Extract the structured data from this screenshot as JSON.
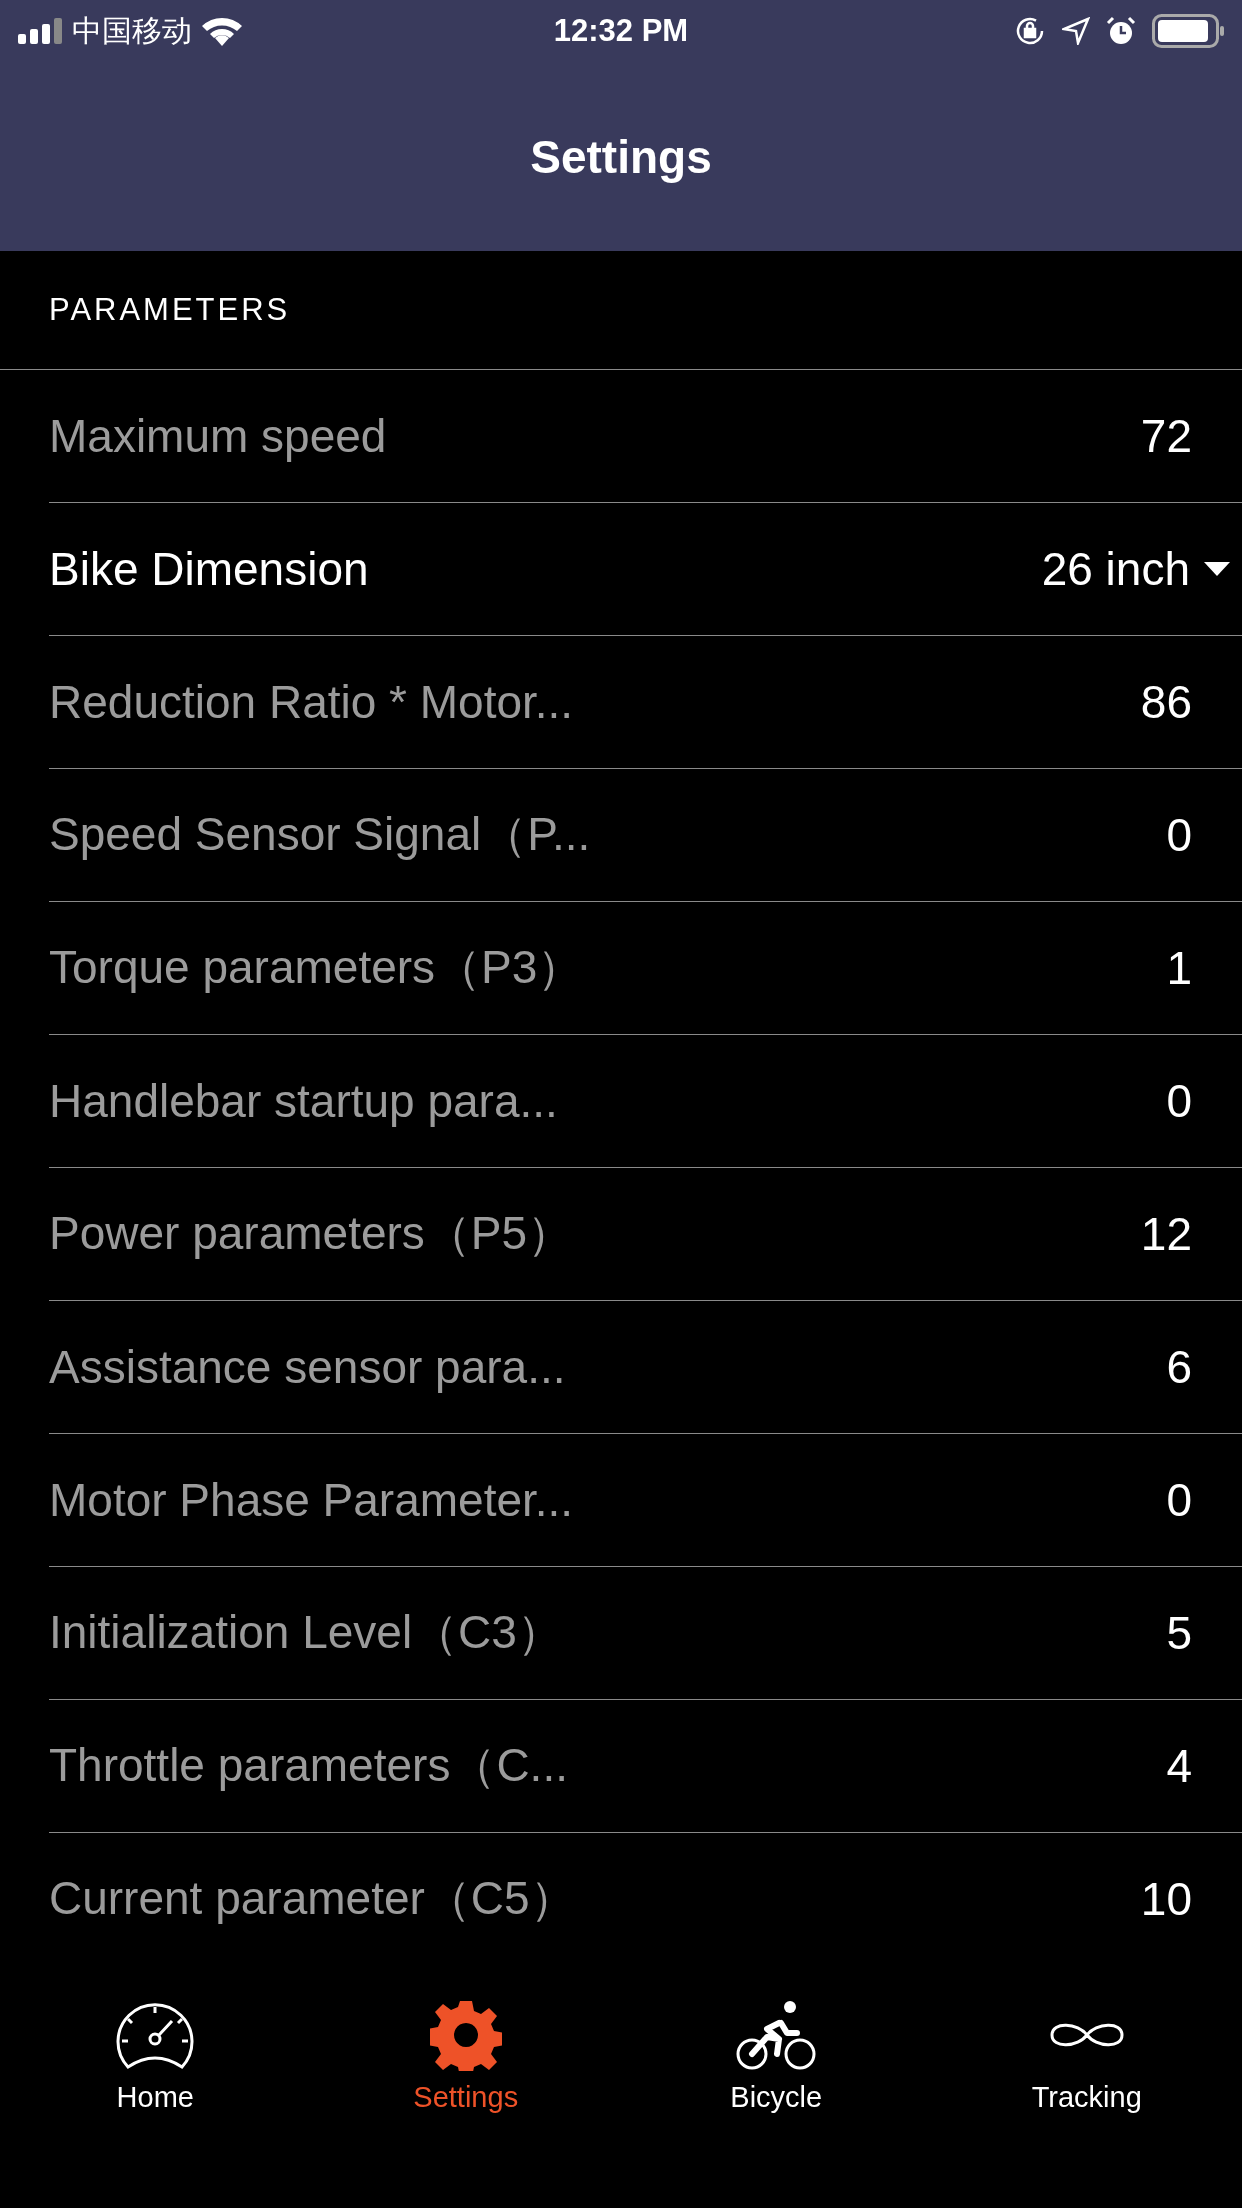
{
  "status_bar": {
    "carrier": "中国移动",
    "time": "12:32 PM"
  },
  "nav_bar": {
    "title": "Settings"
  },
  "section": {
    "header": "PARAMETERS"
  },
  "rows": [
    {
      "kind": "value",
      "label": "Maximum speed",
      "value": "72",
      "disabled": true
    },
    {
      "kind": "dropdown",
      "label": "Bike Dimension",
      "value": "26 inch",
      "disabled": false
    },
    {
      "kind": "value",
      "label": "Reduction Ratio * Motor...",
      "value": "86",
      "disabled": true
    },
    {
      "kind": "value",
      "label": "Speed Sensor Signal（P...",
      "value": "0",
      "disabled": true
    },
    {
      "kind": "value",
      "label": "Torque parameters（P3）",
      "value": "1",
      "disabled": true
    },
    {
      "kind": "value",
      "label": "Handlebar startup para...",
      "value": "0",
      "disabled": true
    },
    {
      "kind": "value",
      "label": "Power parameters（P5）",
      "value": "12",
      "disabled": true
    },
    {
      "kind": "value",
      "label": "Assistance sensor para...",
      "value": "6",
      "disabled": true
    },
    {
      "kind": "value",
      "label": "Motor Phase Parameter...",
      "value": "0",
      "disabled": true
    },
    {
      "kind": "value",
      "label": "Initialization Level（C3）",
      "value": "5",
      "disabled": true
    },
    {
      "kind": "value",
      "label": "Throttle parameters（C...",
      "value": "4",
      "disabled": true
    },
    {
      "kind": "value",
      "label": "Current parameter（C5）",
      "value": "10",
      "disabled": true
    }
  ],
  "tab_bar": [
    {
      "kind": "gauge",
      "label": "Home",
      "selected": false
    },
    {
      "kind": "gear",
      "label": "Settings",
      "selected": true
    },
    {
      "kind": "bicycle",
      "label": "Bicycle",
      "selected": false
    },
    {
      "kind": "infinity",
      "label": "Tracking",
      "selected": false
    }
  ]
}
